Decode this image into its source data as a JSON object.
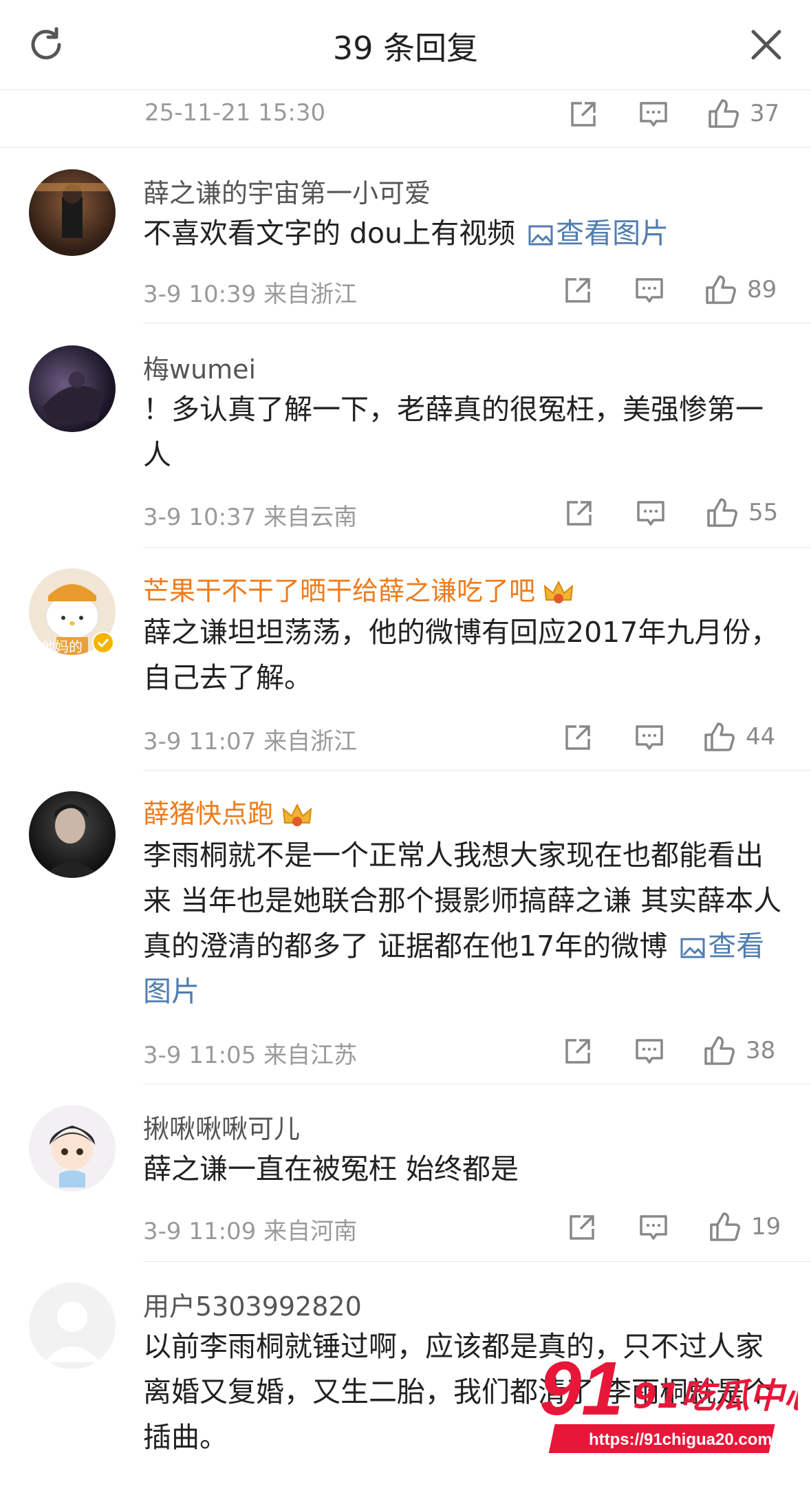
{
  "header": {
    "title": "39 条回复",
    "refresh_icon": "refresh-icon",
    "close_icon": "close-icon"
  },
  "top_meta": {
    "time": "25-11-21 15:30",
    "likes": "37"
  },
  "comments": [
    {
      "user": "薛之谦的宇宙第一小可爱",
      "text": "不喜欢看文字的 dou上有视频 ",
      "link": "查看图片",
      "time": "3-9 10:39",
      "location": "来自浙江",
      "likes": "89"
    },
    {
      "user": "梅wumei",
      "text": "！多认真了解一下，老薛真的很冤枉，美强惨第一人",
      "time": "3-9 10:37",
      "location": "来自云南",
      "likes": "55"
    },
    {
      "user": "芒果干不干了晒干给薛之谦吃了吧",
      "text": "薛之谦坦坦荡荡，他的微博有回应2017年九月份，自己去了解。",
      "time": "3-9 11:07",
      "location": "来自浙江",
      "likes": "44",
      "vip": true,
      "avatar_caption": "他妈的"
    },
    {
      "user": "薛猪快点跑",
      "text": "李雨桐就不是一个正常人我想大家现在也都能看出来 当年也是她联合那个摄影师搞薛之谦 其实薛本人真的澄清的都多了 证据都在他17年的微博 ",
      "link": "查看图片",
      "time": "3-9 11:05",
      "location": "来自江苏",
      "likes": "38",
      "vip": true
    },
    {
      "user": "揪啾啾啾可儿",
      "text": "薛之谦一直在被冤枉 始终都是",
      "time": "3-9 11:09",
      "location": "来自河南",
      "likes": "19"
    },
    {
      "user": "用户5303992820",
      "text": "以前李雨桐就锤过啊，应该都是真的，只不过人家离婚又复婚，又生二胎，我们都清了 李雨桐就是个插曲。"
    }
  ],
  "watermark": {
    "brand": "91吃瓜中心",
    "url": "https://91chigua20.com"
  },
  "colors": {
    "accent_link": "#507daf",
    "vip_name": "#ee7b1c",
    "meta_gray": "#9a9a9a"
  }
}
